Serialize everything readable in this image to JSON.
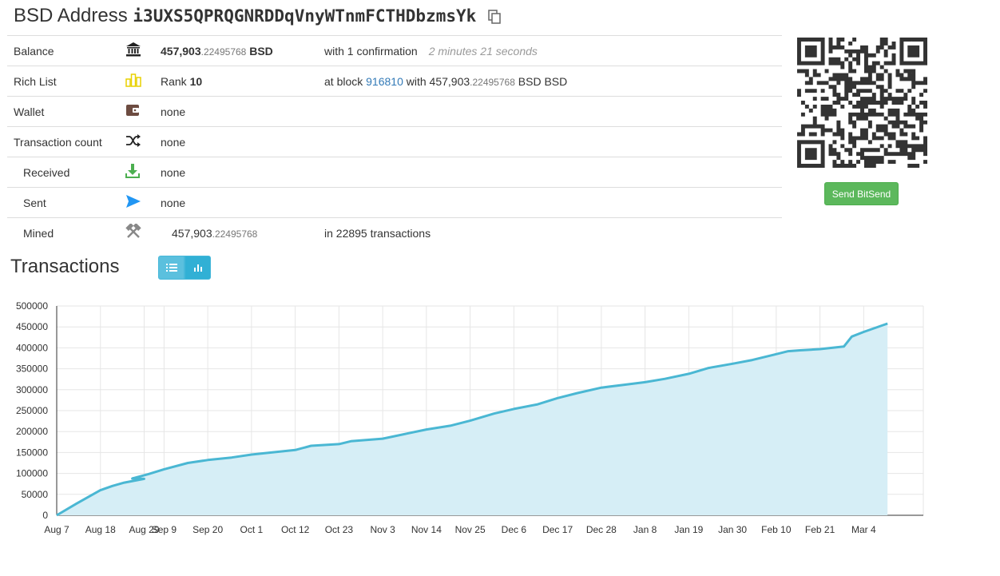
{
  "header": {
    "label": "BSD Address",
    "address": "i3UXS5QPRQGNRDDqVnyWTnmFCTHDbzmsYk"
  },
  "rows": {
    "balance": {
      "label": "Balance",
      "amount_int": "457,903",
      "amount_dec": ".22495768",
      "unit": "BSD",
      "confirm": "with 1 confirmation",
      "ago": "2 minutes 21 seconds"
    },
    "richlist": {
      "label": "Rich List",
      "rank_prefix": "Rank",
      "rank": "10",
      "at_block": "at block",
      "block": "916810",
      "with_text": "with 457,903",
      "with_dec": ".22495768",
      "with_unit": "BSD BSD"
    },
    "wallet": {
      "label": "Wallet",
      "value": "none"
    },
    "txcount": {
      "label": "Transaction count",
      "value": "none"
    },
    "received": {
      "label": "Received",
      "value": "none"
    },
    "sent": {
      "label": "Sent",
      "value": "none"
    },
    "mined": {
      "label": "Mined",
      "amount_int": "457,903",
      "amount_dec": ".22495768",
      "info": "in 22895 transactions"
    }
  },
  "send_button": "Send BitSend",
  "transactions_heading": "Transactions",
  "colors": {
    "line": "#4ab7d3",
    "area": "#d6eef6",
    "button": "#5cb85c",
    "toggle": "#5bc0de"
  },
  "chart_data": {
    "type": "area",
    "x_ticks": [
      "Aug 7",
      "Aug 18",
      "Aug 29",
      "Sep 9",
      "Sep 20",
      "Oct 1",
      "Oct 12",
      "Oct 23",
      "Nov 3",
      "Nov 14",
      "Nov 25",
      "Dec 6",
      "Dec 17",
      "Dec 28",
      "Jan 8",
      "Jan 19",
      "Jan 30",
      "Feb 10",
      "Feb 21",
      "Mar 4"
    ],
    "y_ticks": [
      "500000",
      "450000",
      "400000",
      "350000",
      "300000",
      "250000",
      "200000",
      "150000",
      "100000",
      "50000",
      "0"
    ],
    "ylim": [
      0,
      500000
    ],
    "grid": true,
    "x_day_span": 218,
    "points": [
      [
        "Aug 7",
        0
      ],
      [
        "Aug 12",
        28000
      ],
      [
        "Aug 15",
        44000
      ],
      [
        "Aug 18",
        60000
      ],
      [
        "Aug 21",
        70000
      ],
      [
        "Aug 24",
        78000
      ],
      [
        "Aug 29",
        87000
      ],
      [
        "Sep 1",
        88000
      ],
      [
        "Sep 5",
        98000
      ],
      [
        "Sep 9",
        110000
      ],
      [
        "Sep 15",
        125000
      ],
      [
        "Sep 20",
        132000
      ],
      [
        "Sep 26",
        138000
      ],
      [
        "Oct 1",
        145000
      ],
      [
        "Oct 6",
        150000
      ],
      [
        "Oct 12",
        156000
      ],
      [
        "Oct 16",
        166000
      ],
      [
        "Oct 23",
        170000
      ],
      [
        "Oct 26",
        177000
      ],
      [
        "Nov 3",
        183000
      ],
      [
        "Nov 9",
        195000
      ],
      [
        "Nov 14",
        205000
      ],
      [
        "Nov 20",
        214000
      ],
      [
        "Nov 25",
        226000
      ],
      [
        "Dec 1",
        243000
      ],
      [
        "Dec 6",
        254000
      ],
      [
        "Dec 12",
        265000
      ],
      [
        "Dec 17",
        280000
      ],
      [
        "Dec 22",
        292000
      ],
      [
        "Dec 28",
        305000
      ],
      [
        "Jan 3",
        312000
      ],
      [
        "Jan 8",
        318000
      ],
      [
        "Jan 13",
        326000
      ],
      [
        "Jan 19",
        338000
      ],
      [
        "Jan 24",
        352000
      ],
      [
        "Jan 30",
        362000
      ],
      [
        "Feb 4",
        371000
      ],
      [
        "Feb 10",
        385000
      ],
      [
        "Feb 13",
        392000
      ],
      [
        "Feb 16",
        394000
      ],
      [
        "Feb 21",
        397000
      ],
      [
        "Feb 27",
        403000
      ],
      [
        "Mar 1",
        427000
      ],
      [
        "Mar 4",
        438000
      ],
      [
        "Mar 10",
        458000
      ]
    ]
  }
}
